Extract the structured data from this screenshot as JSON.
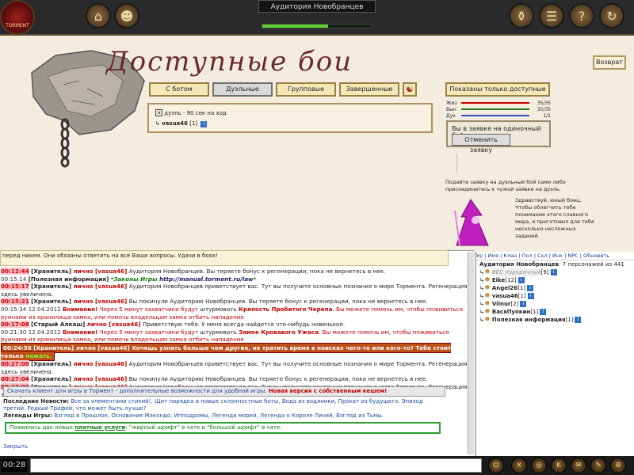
{
  "header": {
    "title": "Аудитория Новобранцев",
    "logo_text": "TORMENT",
    "progress": 0.6,
    "icons": [
      "home-icon",
      "character-icon",
      "inventory-icon",
      "scroll-icon",
      "help-icon",
      "exit-icon"
    ]
  },
  "page": {
    "title": "Доступные бои",
    "back_label": "Возврат"
  },
  "tabs": [
    {
      "label": "С ботом",
      "active": false
    },
    {
      "label": "Дуэльные",
      "active": true
    },
    {
      "label": "Групповые",
      "active": false
    },
    {
      "label": "Завершенные",
      "active": false
    }
  ],
  "show_label": "Показаны только доступные",
  "duel": {
    "row1": "дуэль - 90 сек на ход",
    "player": "vasua46",
    "level": "[1]"
  },
  "stats": [
    {
      "label": "Жиз",
      "value": "35/35",
      "color": "#c00000"
    },
    {
      "label": "Вын",
      "value": "35/35",
      "color": "#208020"
    },
    {
      "label": "Дух",
      "value": "1/1",
      "color": "#3050c0"
    }
  ],
  "queue": {
    "text": "Вы в заявке на одиночный бой",
    "cancel_label": "Отменить заявку"
  },
  "hint_duel": "Подайте заявку на дуэльный бой сами либо присоединитесь к чужой заявке на дуэль.",
  "hint_wizard": "Здравствуй, юный боец. Чтобы облегчить тебе понимание этого славного мира, я приготовил для тебя несколько несложных заданий.",
  "chat": {
    "banner": "перед никем. Они обязаны ответить на все Ваши вопросы. Удачи в боях!",
    "lines": [
      {
        "time": "00:12:44",
        "time_red": true,
        "name": "[Хранитель]",
        "private": "лично [vasua46]",
        "text": "Аудитория Новобранцев. Вы теряете бонус к регенерации, пока не вернетесь в нее."
      },
      {
        "time": "00:15:14",
        "time_red": false,
        "name": "[Полезная информация]",
        "private": "",
        "text": "",
        "law": "*Законы Игры",
        "url": "http://manual.torment.ru/law",
        "law_end": "*"
      },
      {
        "time": "00:15:17",
        "time_red": true,
        "name": "[Хранитель]",
        "private": "лично [vasua46]",
        "text": "Аудитория Новобранцев приветствует вас. Тут вы получите основные познания о мире Тормента. Регенерация здесь увеличена."
      },
      {
        "time": "00:15:21",
        "time_red": true,
        "name": "[Хранитель]",
        "private": "лично [vasua46]",
        "text": "Вы покинули Аудиторию Новобранцев. Вы теряете бонус к регенерации, пока не вернетесь в нее."
      },
      {
        "time": "00:15:34 12.04.2012",
        "time_red": false,
        "name": "",
        "warn": "Внимание!",
        "text1": "Через 5 минут захватчики будут",
        "storm": "штурмовать",
        "place": "Крепость Пробитого Черепа",
        "text2": ". Вы можете помочь им, чтобы поживиться руинами из хранилища замка, или помочь владельцам замка отбить нападение"
      },
      {
        "time": "00:17:08",
        "time_red": true,
        "name": "[Старый Алкаш]",
        "private": "лично [vasua46]",
        "text": "Приветствую тебя. У меня всегда найдется что-нибудь новенькое."
      },
      {
        "time": "00:21:30 12.04.2012",
        "time_red": false,
        "name": "",
        "warn": "Внимание!",
        "text1": "Через 5 минут захватчики будут",
        "storm": "штурмовать",
        "place": "Замок Кровавого Ужаса",
        "text2": ". Вы можете помочь им, чтобы поживиться руинами из хранилища замка, или помочь владельцам замка отбить нападение"
      },
      {
        "time": "00:24:56",
        "highlight": true,
        "name": "[Хранитель]",
        "private": "лично [vasua46]",
        "text": "Хочешь узнать больше чем другие, не тратить время в поисках чего-то или кого-то? Тебе стоит только",
        "extra": "нажать."
      },
      {
        "time": "00:27:00",
        "time_red": true,
        "name": "[Хранитель]",
        "private": "лично [vasua46]",
        "text": "Аудитория Новобранцев приветствует вас. Тут вы получите основные познания о мире Тормента. Регенерация здесь увеличена."
      },
      {
        "time": "00:27:04",
        "time_red": true,
        "name": "[Хранитель]",
        "private": "лично [vasua46]",
        "text": "Вы покинули Аудиторию Новобранцев. Вы теряете бонус к регенерации, пока не вернетесь в нее."
      },
      {
        "time": "00:27:06",
        "time_red": true,
        "name": "[Хранитель]",
        "private": "лично [vasua46]",
        "text": "Аудитория Новобранцев приветствует вас. Тут вы получите основные познания о мире Тормента. Регенерация здесь увеличена."
      }
    ]
  },
  "news": {
    "download_text": "Скачать клиент для игры в Тормент - дополнительные возможности для удобной игры.",
    "download_new": "Новая версия с собственным кешем!",
    "latest_label": "Последние Новости:",
    "latest": "Все за элементами стихий!, Щит порядка и новые склонностные боты, Вода из водяники, Прокат из будущего. Эпизод третий. Редкий Трофей, что может быть лучше?",
    "legends_label": "Легенды Игры:",
    "legends": "Взгляд в Прошлое, Основание Макондо, Ипподромы, Легенда морей, Легенда о Короле Личей, Взгляд из Тьмы.",
    "paid_text1": "Появились две новые",
    "paid_link": "платные услуги",
    "paid_text2": ": \"жирный шрифт\" в чате и \"большой шрифт\" в чате.",
    "close": "Закрыть"
  },
  "userlist": {
    "menu": "Ур | Имя | Клан | Пол | Скл | Инк | NPC | Обновить",
    "location": "Аудитория Новобранцев",
    "count": ": 7 персонажей из 441",
    "users": [
      {
        "name": "ВЕС порядочный",
        "level": "[9]"
      },
      {
        "name": "Eike",
        "level": "[12]"
      },
      {
        "name": "Angel26",
        "level": "[1]"
      },
      {
        "name": "vasua46",
        "level": "[1]"
      },
      {
        "name": "Vilnur",
        "level": "[2]"
      },
      {
        "name": "ВасяПупкин",
        "level": "[1]"
      },
      {
        "name": "Полезная информация",
        "level": "[1]"
      }
    ]
  },
  "footer": {
    "time": "00:28"
  }
}
